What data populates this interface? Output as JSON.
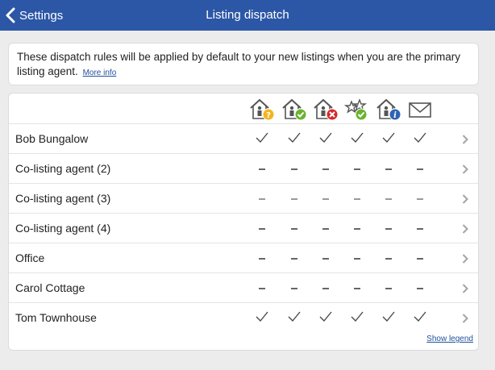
{
  "nav": {
    "back_label": "Settings",
    "title": "Listing dispatch"
  },
  "intro": {
    "text": "These dispatch rules will be applied by default to your new listings when you are the primary listing agent.",
    "more_info": "More info"
  },
  "columns": [
    {
      "icon": "house-agent-question-icon",
      "badge_color": "#f2b51c"
    },
    {
      "icon": "house-agent-check-icon",
      "badge_color": "#6bb32f"
    },
    {
      "icon": "house-agent-cross-icon",
      "badge_color": "#d62828"
    },
    {
      "icon": "stars-check-icon",
      "badge_color": "#6bb32f"
    },
    {
      "icon": "house-agent-info-icon",
      "badge_color": "#2f63b3"
    },
    {
      "icon": "envelope-icon",
      "badge_color": ""
    }
  ],
  "rows": [
    {
      "label": "Bob Bungalow",
      "cells": [
        "check",
        "check",
        "check",
        "check",
        "check",
        "check"
      ]
    },
    {
      "label": "Co-listing agent (2)",
      "cells": [
        "dash",
        "dash",
        "dash",
        "dash",
        "dash",
        "dash"
      ]
    },
    {
      "label": "Co-listing agent (3)",
      "cells": [
        "dash",
        "dash",
        "dash",
        "dash",
        "dash",
        "dash"
      ]
    },
    {
      "label": "Co-listing agent (4)",
      "cells": [
        "dash",
        "dash",
        "dash",
        "dash",
        "dash",
        "dash"
      ]
    },
    {
      "label": "Office",
      "cells": [
        "dash",
        "dash",
        "dash",
        "dash",
        "dash",
        "dash"
      ]
    },
    {
      "label": "Carol Cottage",
      "cells": [
        "dash",
        "dash",
        "dash",
        "dash",
        "dash",
        "dash"
      ]
    },
    {
      "label": "Tom Townhouse",
      "cells": [
        "check",
        "check",
        "check",
        "check",
        "check",
        "check"
      ]
    }
  ],
  "show_legend": "Show legend"
}
